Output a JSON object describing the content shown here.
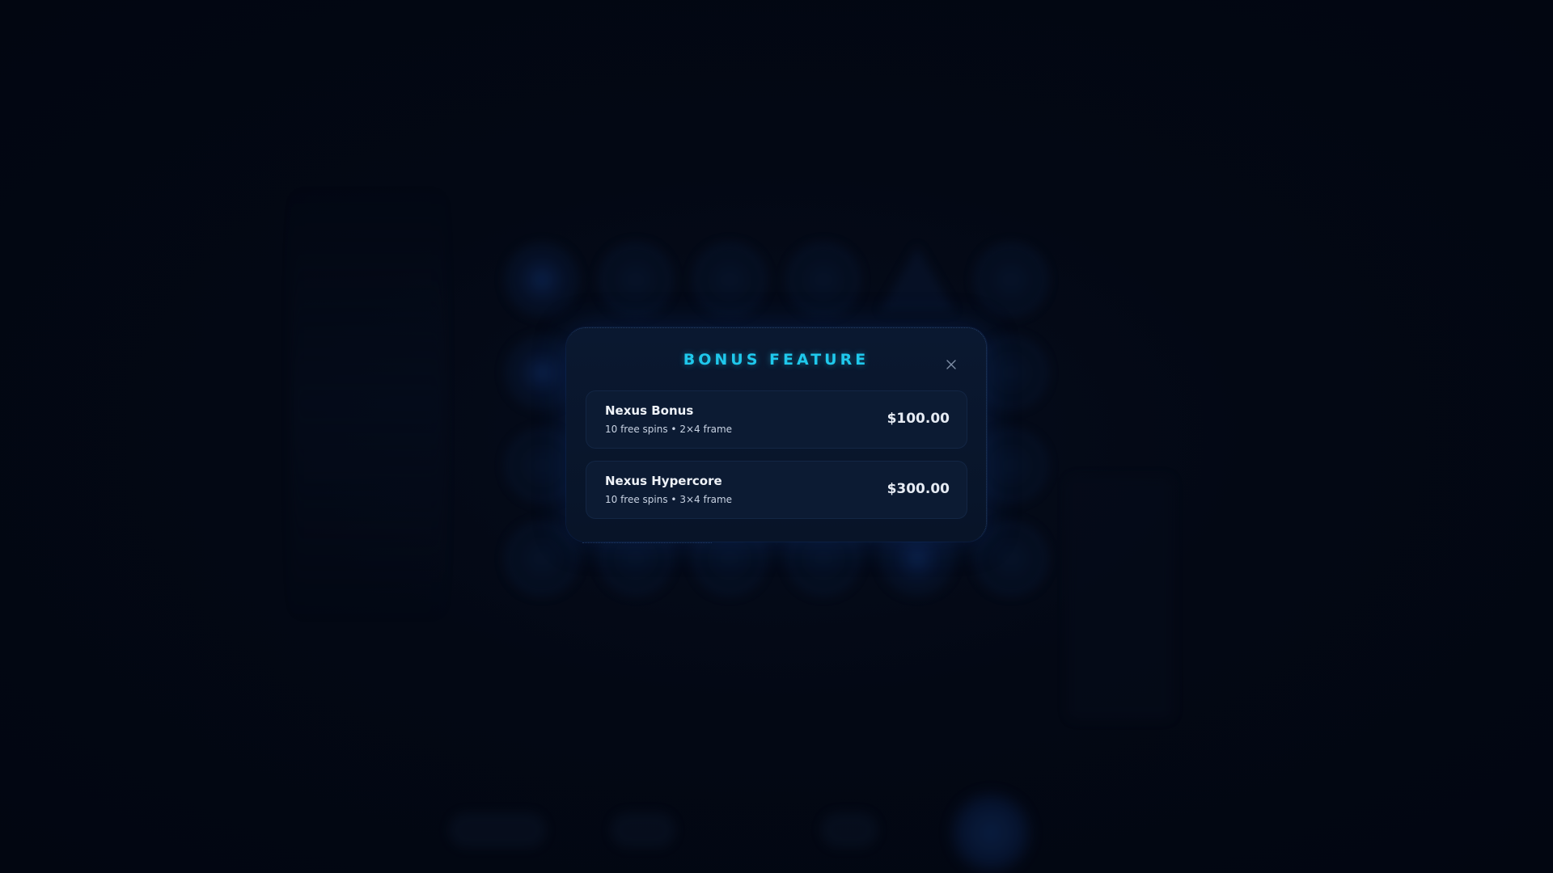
{
  "modal": {
    "title": "BONUS FEATURE",
    "close_icon": "close-icon",
    "options": [
      {
        "name": "Nexus Bonus",
        "description": "10 free spins • 2×4 frame",
        "price": "$100.00"
      },
      {
        "name": "Nexus Hypercore",
        "description": "10 free spins • 3×4 frame",
        "price": "$300.00"
      }
    ]
  },
  "colors": {
    "accent": "#1fc8ec",
    "background": "#020611",
    "modal_bg": "#0a1830",
    "option_bg": "#0c1b33",
    "text_primary": "#eef2f8"
  }
}
